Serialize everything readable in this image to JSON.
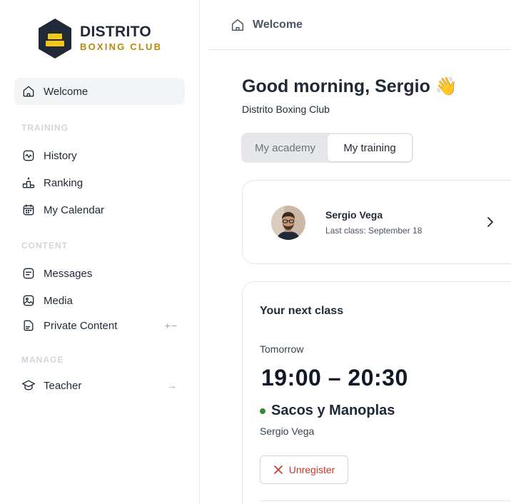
{
  "brand": {
    "title": "DISTRITO",
    "subtitle": "BOXING CLUB",
    "accent": "#b8860b"
  },
  "sidebar": {
    "welcome": {
      "label": "Welcome",
      "icon": "home-icon",
      "active": true
    },
    "sections": [
      {
        "title": "TRAINING",
        "items": [
          {
            "label": "History",
            "icon": "activity-icon"
          },
          {
            "label": "Ranking",
            "icon": "podium-icon"
          },
          {
            "label": "My Calendar",
            "icon": "calendar-icon"
          }
        ]
      },
      {
        "title": "CONTENT",
        "items": [
          {
            "label": "Messages",
            "icon": "message-icon"
          },
          {
            "label": "Media",
            "icon": "image-icon"
          },
          {
            "label": "Private Content",
            "icon": "document-icon",
            "trail": "+−"
          }
        ]
      },
      {
        "title": "MANAGE",
        "items": [
          {
            "label": "Teacher",
            "icon": "graduation-cap-icon",
            "trail": "→"
          }
        ]
      }
    ]
  },
  "topbar": {
    "breadcrumb": "Welcome",
    "icon": "home-icon"
  },
  "main": {
    "greeting": "Good morning, Sergio",
    "greeting_emoji": "👋",
    "club": "Distrito Boxing Club",
    "tabs": [
      {
        "label": "My academy",
        "active": false
      },
      {
        "label": "My training",
        "active": true
      }
    ],
    "profile": {
      "name": "Sergio Vega",
      "last_class": "Last class: September 18"
    },
    "next_class": {
      "title": "Your next class",
      "when": "Tomorrow",
      "time": "19:00 – 20:30",
      "class_name": "Sacos y Manoplas",
      "status_color": "#2e8b3e",
      "teacher": "Sergio Vega",
      "unregister_label": "Unregister",
      "unregister_color": "#c0392b"
    }
  }
}
